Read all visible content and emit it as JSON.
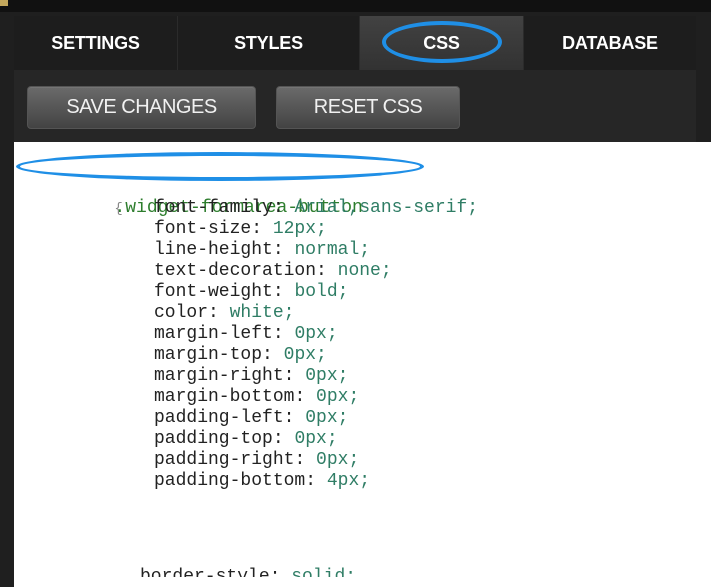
{
  "tabs": {
    "items": [
      {
        "label": "SETTINGS",
        "active": false
      },
      {
        "label": "STYLES",
        "active": false
      },
      {
        "label": "CSS",
        "active": true
      },
      {
        "label": "DATABASE",
        "active": false
      }
    ]
  },
  "toolbar": {
    "save_label": "SAVE CHANGES",
    "reset_label": "RESET CSS"
  },
  "editor": {
    "selector": ".widget-formarea-button",
    "open_brace": "{",
    "declarations": [
      {
        "property": "font-family",
        "value": "Arial,sans-serif;"
      },
      {
        "property": "font-size",
        "value": "12px;"
      },
      {
        "property": "line-height",
        "value": "normal;"
      },
      {
        "property": "text-decoration",
        "value": "none;"
      },
      {
        "property": "font-weight",
        "value": "bold;"
      },
      {
        "property": "color",
        "value": "white;"
      },
      {
        "property": "margin-left",
        "value": "0px;"
      },
      {
        "property": "margin-top",
        "value": "0px;"
      },
      {
        "property": "margin-right",
        "value": "0px;"
      },
      {
        "property": "margin-bottom",
        "value": "0px;"
      },
      {
        "property": "padding-left",
        "value": "0px;"
      },
      {
        "property": "padding-top",
        "value": "0px;"
      },
      {
        "property": "padding-right",
        "value": "0px;"
      },
      {
        "property": "padding-bottom",
        "value": "4px;"
      },
      {
        "property": "border-style",
        "value": "solid;"
      }
    ]
  },
  "colors": {
    "accent_highlight": "#1f8fe6",
    "toolbar_bg": "#262626",
    "tab_bg": "#1d1d1d",
    "selector_text": "#2d7d2d",
    "value_text": "#2f7d65"
  }
}
